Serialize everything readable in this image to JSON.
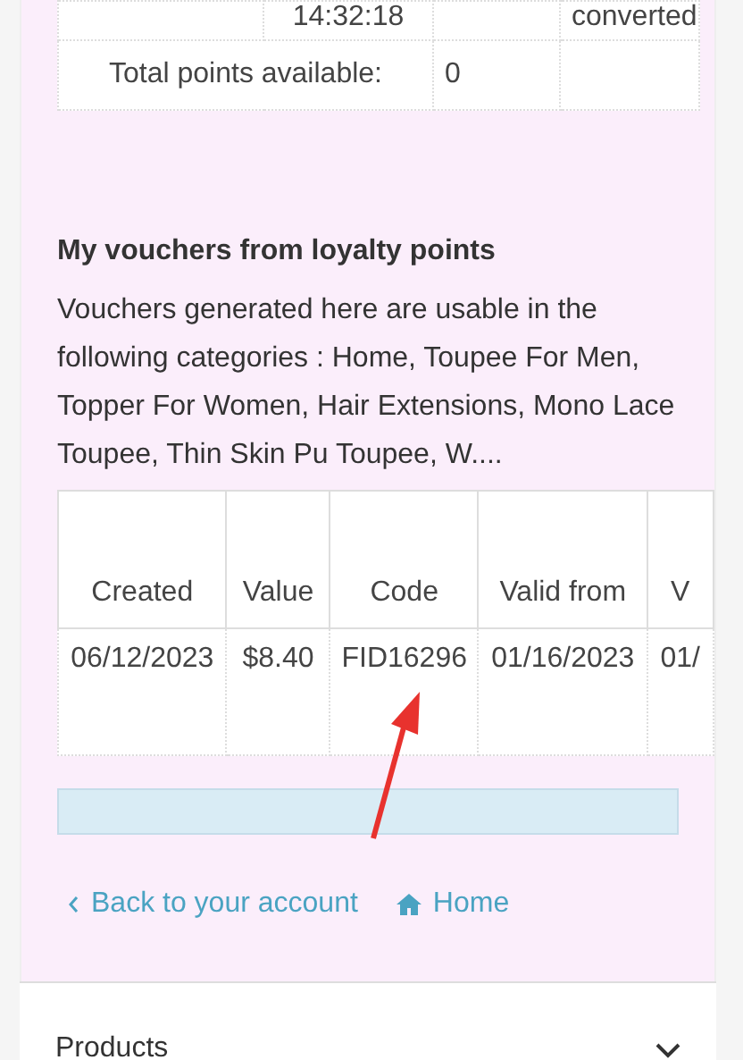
{
  "points_table": {
    "rows": [
      {
        "cells": [
          "",
          "14:32:18",
          "",
          "converted"
        ]
      }
    ],
    "total_label": "Total points available:",
    "total_value": "0"
  },
  "vouchers": {
    "title": "My vouchers from loyalty points",
    "description": "Vouchers generated here are usable in the following categories : Home, Toupee For Men, Topper For Women, Hair Extensions, Mono Lace Toupee, Thin Skin Pu Toupee, W....",
    "columns": [
      "Created",
      "Value",
      "Code",
      "Valid from",
      "V"
    ],
    "rows": [
      {
        "cells": [
          "06/12/2023",
          "$8.40",
          "FID16296",
          "01/16/2023",
          "01/"
        ]
      }
    ]
  },
  "links": [
    {
      "kind": "back",
      "label": "Back to your account"
    },
    {
      "kind": "home",
      "label": "Home"
    }
  ],
  "footer": {
    "section": "Products",
    "expanded": false
  }
}
